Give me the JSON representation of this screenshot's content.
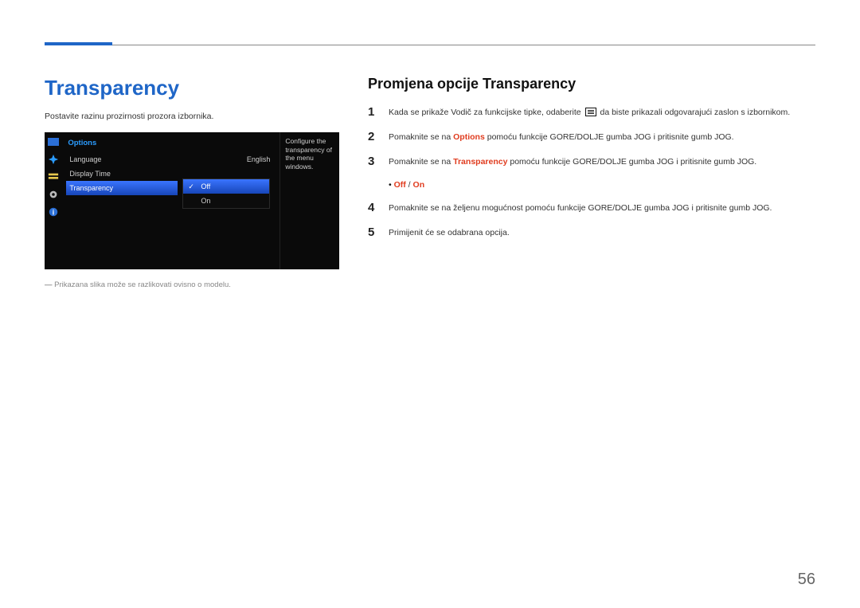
{
  "page_number": "56",
  "title": "Transparency",
  "description": "Postavite razinu prozirnosti prozora izbornika.",
  "osd": {
    "panel_title": "Options",
    "rows": {
      "language": {
        "label": "Language",
        "value": "English"
      },
      "display_time": {
        "label": "Display Time"
      },
      "transparency": {
        "label": "Transparency"
      }
    },
    "popup": {
      "off": "Off",
      "on": "On"
    },
    "help_text": "Configure the transparency of the menu windows."
  },
  "footnote": "Prikazana slika može se razlikovati ovisno o modelu.",
  "right": {
    "heading": "Promjena opcije Transparency",
    "steps": {
      "1_a": "Kada se prikaže Vodič za funkcijske tipke, odaberite ",
      "1_b": " da biste prikazali odgovarajući zaslon s izbornikom.",
      "2_a": "Pomaknite se na ",
      "2_kw": "Options",
      "2_b": " pomoću funkcije GORE/DOLJE gumba JOG i pritisnite gumb JOG.",
      "3_a": "Pomaknite se na ",
      "3_kw": "Transparency",
      "3_b": " pomoću funkcije GORE/DOLJE gumba JOG i pritisnite gumb JOG.",
      "bullet_off": "Off",
      "bullet_sep": " / ",
      "bullet_on": "On",
      "4": "Pomaknite se na željenu mogućnost pomoću funkcije GORE/DOLJE gumba JOG i pritisnite gumb JOG.",
      "5": "Primijenit će se odabrana opcija."
    }
  }
}
